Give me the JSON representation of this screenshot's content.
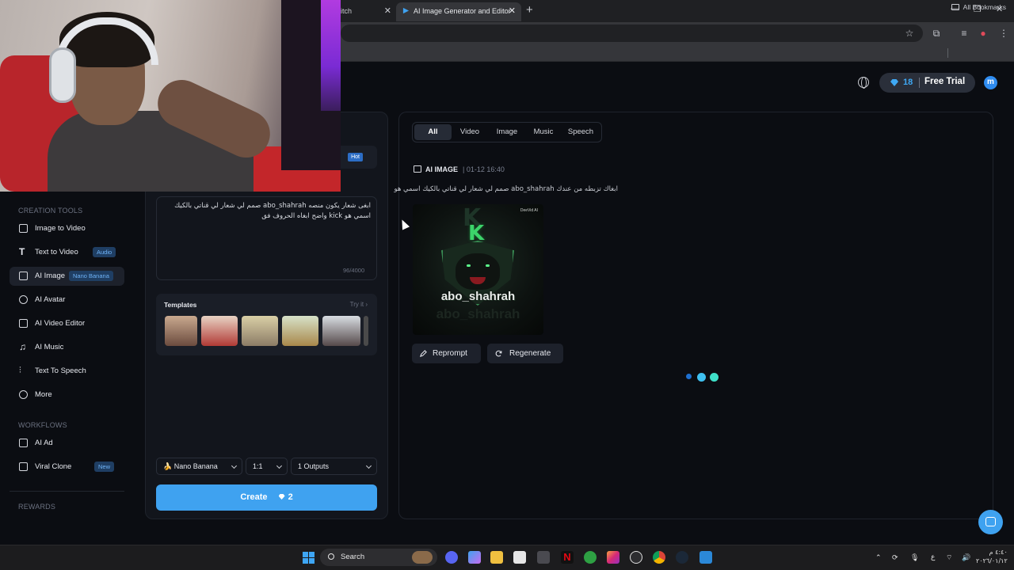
{
  "browser": {
    "tabs": [
      {
        "title": "itch"
      },
      {
        "title": "AI Image Generator and Editor"
      }
    ],
    "bookmarks": {
      "all_label": "All Bookmarks"
    }
  },
  "header": {
    "credits": "18",
    "free_trial": "Free Trial",
    "avatar_initial": "m"
  },
  "sidebar": {
    "creation_title": "CREATION TOOLS",
    "creation_items": [
      {
        "label": "Image to Video",
        "icon": "image-video-icon"
      },
      {
        "label": "Text to Video",
        "icon": "text-icon",
        "badge": "Audio"
      },
      {
        "label": "AI Image",
        "icon": "image-icon",
        "badge": "Nano Banana",
        "active": true
      },
      {
        "label": "AI Avatar",
        "icon": "avatar-icon"
      },
      {
        "label": "AI Video Editor",
        "icon": "edit-icon"
      },
      {
        "label": "AI Music",
        "icon": "music-icon"
      },
      {
        "label": "Text To Speech",
        "icon": "waveform-icon"
      },
      {
        "label": "More",
        "icon": "more-icon"
      }
    ],
    "workflows_title": "WORKFLOWS",
    "workflow_items": [
      {
        "label": "AI Ad",
        "icon": "ad-icon"
      },
      {
        "label": "Viral Clone",
        "icon": "clone-icon",
        "badge": "New"
      }
    ],
    "rewards_title": "REWARDS"
  },
  "editor": {
    "hot_badge": "Hot",
    "prompt_text": "ابغى شعار يكون منصه abo_shahrah صمم لي شعار لي قناتي بالكيك اسمي هو kick واضح ابغاه الحروف فق",
    "prompt_count": "96/4000",
    "templates_title": "Templates",
    "templates_try": "Try it",
    "model": "Nano Banana",
    "ratio": "1:1",
    "outputs": "1 Outputs",
    "create_label": "Create",
    "create_cost": "2"
  },
  "results": {
    "filters": [
      "All",
      "Video",
      "Image",
      "Music",
      "Speech"
    ],
    "active_filter": "All",
    "item_type": "AI IMAGE",
    "item_time": "01-12 16:40",
    "item_prompt": "ابغاك تزبطه من عندك abo_shahrah صمم لي شعار لي قناتي بالكيك اسمي هو",
    "image": {
      "watermark": "DeeVid AI",
      "letter": "K",
      "name": "abo_shahrah"
    },
    "reprompt_label": "Reprompt",
    "regenerate_label": "Regenerate"
  },
  "taskbar": {
    "search_label": "Search",
    "clock_time": "٤:٤٠ م",
    "clock_date": "٢٠٢٦/٠١/١٢",
    "lang": "ع"
  },
  "colors": {
    "accent": "#3fa2f0",
    "badge_bg": "#1f3e63",
    "panel_bg": "#12151c",
    "page_bg": "#0b0d12"
  }
}
